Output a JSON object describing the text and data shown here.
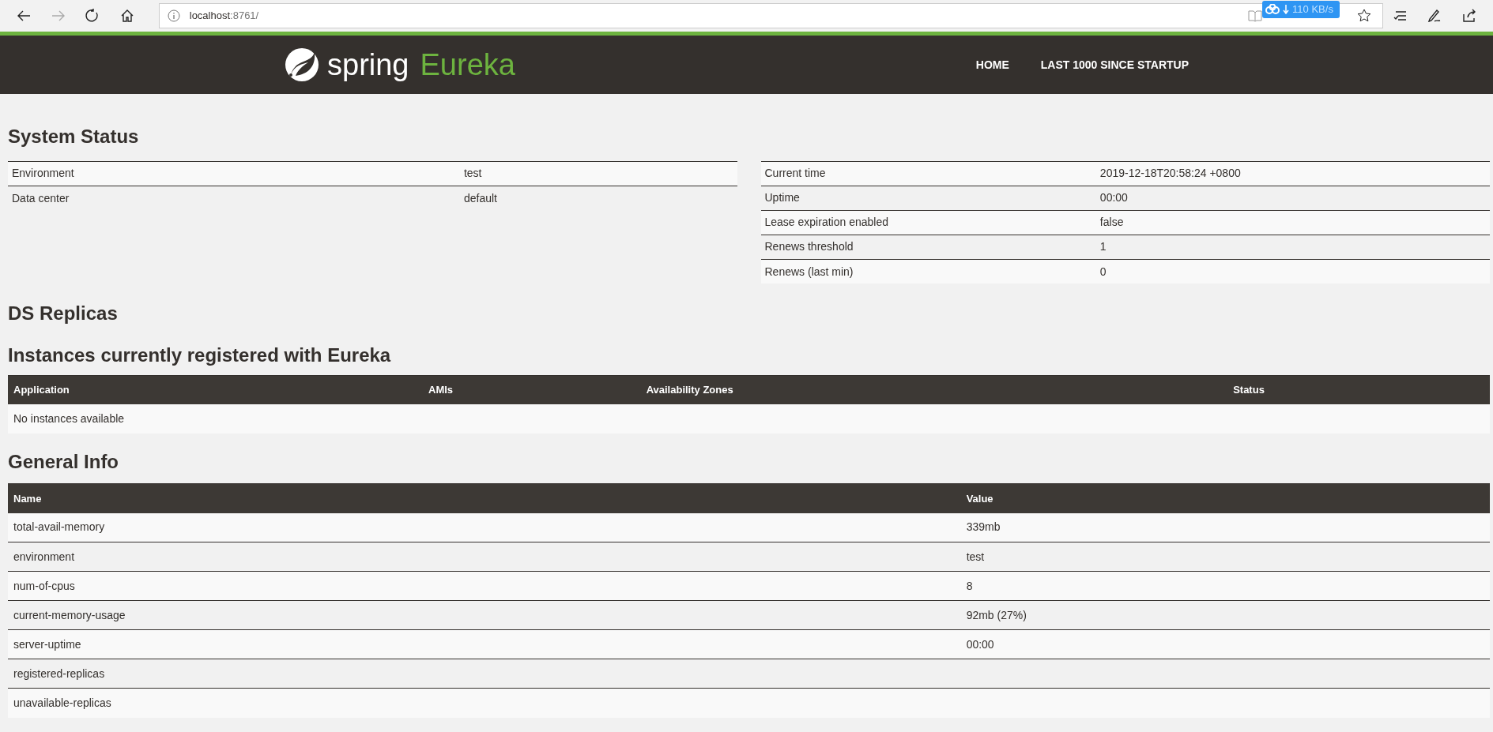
{
  "browser": {
    "back_enabled": true,
    "forward_enabled": false,
    "url_host": "localhost",
    "url_rest": ":8761/",
    "download_speed": "110 KB/s"
  },
  "navbar": {
    "logo_word": "spring",
    "logo_product": "Eureka",
    "links": [
      "HOME",
      "LAST 1000 SINCE STARTUP"
    ]
  },
  "system_status": {
    "title": "System Status",
    "left_rows": [
      {
        "name": "Environment",
        "value": "test"
      },
      {
        "name": "Data center",
        "value": "default"
      }
    ],
    "right_rows": [
      {
        "name": "Current time",
        "value": "2019-12-18T20:58:24 +0800"
      },
      {
        "name": "Uptime",
        "value": "00:00"
      },
      {
        "name": "Lease expiration enabled",
        "value": "false"
      },
      {
        "name": "Renews threshold",
        "value": "1"
      },
      {
        "name": "Renews (last min)",
        "value": "0"
      }
    ]
  },
  "ds_replicas": {
    "title": "DS Replicas"
  },
  "instances": {
    "title": "Instances currently registered with Eureka",
    "columns": [
      "Application",
      "AMIs",
      "Availability Zones",
      "Status"
    ],
    "empty_message": "No instances available"
  },
  "general_info": {
    "title": "General Info",
    "columns": [
      "Name",
      "Value"
    ],
    "rows": [
      {
        "name": "total-avail-memory",
        "value": "339mb"
      },
      {
        "name": "environment",
        "value": "test"
      },
      {
        "name": "num-of-cpus",
        "value": "8"
      },
      {
        "name": "current-memory-usage",
        "value": "92mb (27%)"
      },
      {
        "name": "server-uptime",
        "value": "00:00"
      },
      {
        "name": "registered-replicas"
      },
      {
        "name": "unavailable-replicas"
      }
    ]
  }
}
